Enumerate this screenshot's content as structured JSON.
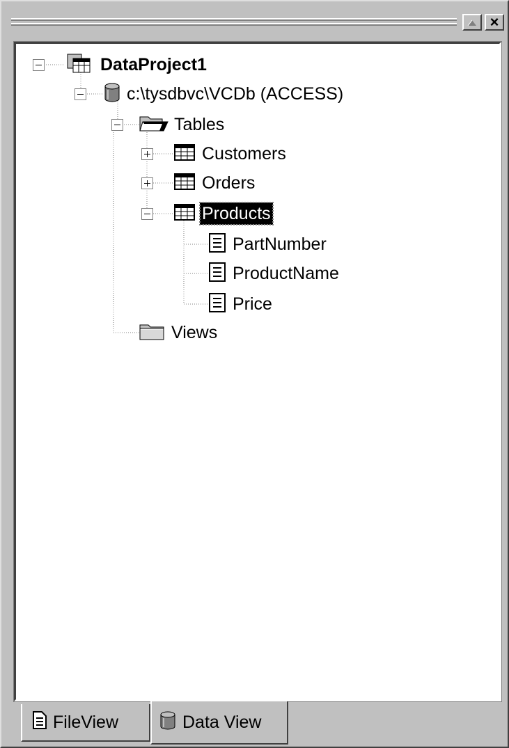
{
  "window": {
    "close_button": "×"
  },
  "tree": {
    "root": {
      "label": "DataProject1",
      "icon": "project-icon"
    },
    "connection": {
      "label": "c:\\tysdbvc\\VCDb (ACCESS)",
      "icon": "database-icon"
    },
    "tables_folder": {
      "label": "Tables",
      "icon": "open-folder-icon"
    },
    "tables": [
      {
        "label": "Customers",
        "icon": "table-icon",
        "expanded": false
      },
      {
        "label": "Orders",
        "icon": "table-icon",
        "expanded": false
      },
      {
        "label": "Products",
        "icon": "table-icon",
        "expanded": true,
        "selected": true
      }
    ],
    "columns": [
      {
        "label": "PartNumber",
        "icon": "column-icon"
      },
      {
        "label": "ProductName",
        "icon": "column-icon"
      },
      {
        "label": "Price",
        "icon": "column-icon"
      }
    ],
    "views_folder": {
      "label": "Views",
      "icon": "closed-folder-icon"
    }
  },
  "tabs": [
    {
      "label": "FileView",
      "icon": "file-view-icon",
      "active": false
    },
    {
      "label": "Data View",
      "icon": "database-icon",
      "active": true
    }
  ]
}
